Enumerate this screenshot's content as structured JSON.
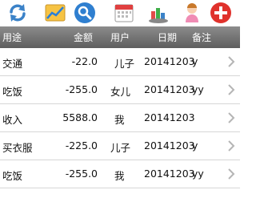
{
  "toolbar": {
    "icons": [
      "refresh-icon",
      "chart-icon",
      "search-icon",
      "calendar-icon",
      "statistics-icon",
      "user-icon",
      "add-icon"
    ]
  },
  "header": {
    "usage": "用途",
    "amount": "金额",
    "user": "用户",
    "date": "日期",
    "note": "备注"
  },
  "rows": [
    {
      "usage": "交通",
      "amount": "-22.0",
      "user": "儿子",
      "date": "20141203",
      "note": "y"
    },
    {
      "usage": "吃饭",
      "amount": "-255.0",
      "user": "女儿",
      "date": "20141203",
      "note": "yy"
    },
    {
      "usage": "收入",
      "amount": "5588.0",
      "user": "我",
      "date": "20141203",
      "note": ""
    },
    {
      "usage": "买衣服",
      "amount": "-225.0",
      "user": "儿子",
      "date": "20141203",
      "note": "y"
    },
    {
      "usage": "吃饭",
      "amount": "-255.0",
      "user": "我",
      "date": "20141203",
      "note": "yy"
    }
  ],
  "colors": {
    "header_bg": "#6f6f6f",
    "add_red": "#e0322c",
    "refresh_blue": "#3b82c8"
  }
}
